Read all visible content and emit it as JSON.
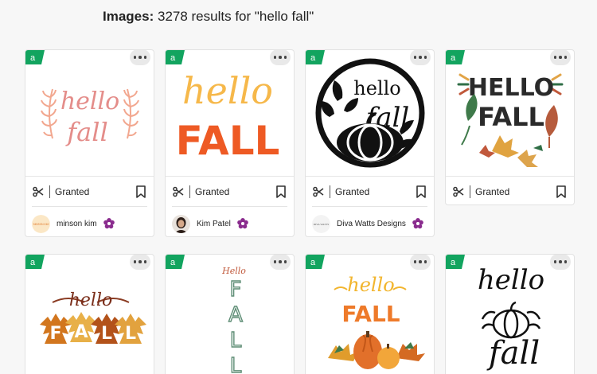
{
  "header": {
    "label": "Images:",
    "results_text": "3278 results for \"hello fall\""
  },
  "colors": {
    "badge_green": "#12a45f",
    "flower_purple": "#8a2c8e",
    "orange": "#ee5a24",
    "peach": "#f2a78f"
  },
  "cards": [
    {
      "art_icon": "hello-fall-laurel-art",
      "art_text": [
        "hello",
        "fall"
      ],
      "status": "Granted",
      "creator": "minson kim",
      "avatar_text": "MINSON KIM"
    },
    {
      "art_icon": "hello-fall-bold-orange-art",
      "art_text": [
        "hello",
        "FALL"
      ],
      "status": "Granted",
      "creator": "Kim Patel"
    },
    {
      "art_icon": "hello-fall-pumpkin-circle-art",
      "art_text": [
        "hello",
        "fall"
      ],
      "status": "Granted",
      "creator": "Diva Watts Designs",
      "avatar_text": "DIVA WATTS"
    },
    {
      "art_icon": "hello-fall-leaves-art",
      "art_text": [
        "HELLO",
        "FALL"
      ],
      "status": "Granted"
    },
    {
      "art_icon": "hello-fall-maple-leaves-art",
      "art_text": [
        "hello",
        "F",
        "A",
        "L",
        "L"
      ]
    },
    {
      "art_icon": "hello-fall-vertical-art",
      "art_text": [
        "Hello",
        "F",
        "A",
        "L",
        "L"
      ]
    },
    {
      "art_icon": "hello-fall-pumpkins-art",
      "art_text": [
        "hello",
        "FALL"
      ]
    },
    {
      "art_icon": "hello-fall-script-pumpkin-art",
      "art_text": [
        "hello",
        "fall"
      ]
    }
  ]
}
